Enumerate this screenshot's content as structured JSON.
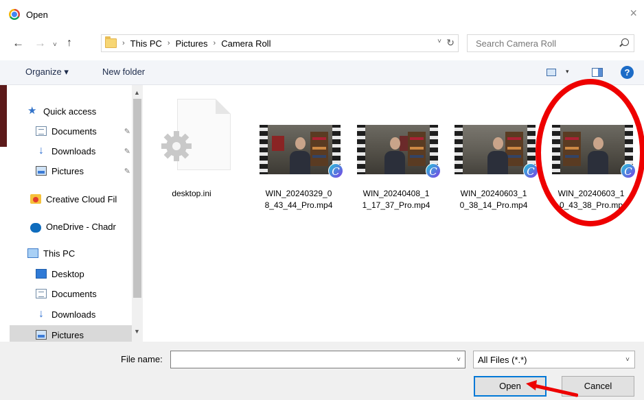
{
  "window": {
    "title": "Open",
    "close_glyph": "×"
  },
  "nav": {
    "back_glyph": "←",
    "forward_glyph": "→",
    "recent_glyph": "˅",
    "up_glyph": "↑",
    "breadcrumbs": [
      "This PC",
      "Pictures",
      "Camera Roll"
    ],
    "separator": "›",
    "address_dropdown_glyph": "˅",
    "refresh_glyph": "↻"
  },
  "search": {
    "placeholder": "Search Camera Roll"
  },
  "toolbar": {
    "organize_label": "Organize ▾",
    "new_folder_label": "New folder",
    "view_caret": "▾",
    "help_glyph": "?"
  },
  "sidebar": {
    "items": [
      {
        "label": "Quick access",
        "icon": "star-icon",
        "pinned": false
      },
      {
        "label": "Documents",
        "icon": "documents-icon",
        "pinned": true
      },
      {
        "label": "Downloads",
        "icon": "downloads-icon",
        "pinned": true
      },
      {
        "label": "Pictures",
        "icon": "pictures-icon",
        "pinned": true
      },
      {
        "label": "Creative Cloud Fil",
        "icon": "creative-cloud-icon",
        "pinned": false
      },
      {
        "label": "OneDrive - Chadr",
        "icon": "onedrive-icon",
        "pinned": false
      },
      {
        "label": "This PC",
        "icon": "this-pc-icon",
        "pinned": false
      },
      {
        "label": "Desktop",
        "icon": "desktop-icon",
        "pinned": false
      },
      {
        "label": "Documents",
        "icon": "documents-icon",
        "pinned": false
      },
      {
        "label": "Downloads",
        "icon": "downloads-icon",
        "pinned": false
      },
      {
        "label": "Pictures",
        "icon": "pictures-icon",
        "pinned": false
      }
    ],
    "pin_glyph": "📌",
    "scroll_up_glyph": "▲",
    "scroll_down_glyph": "▼"
  },
  "files": [
    {
      "label_lines": [
        "desktop.ini",
        ""
      ],
      "kind": "settings-file-icon"
    },
    {
      "label_lines": [
        "WIN_20240329_0",
        "8_43_44_Pro.mp4"
      ],
      "kind": "video-thumbnail"
    },
    {
      "label_lines": [
        "WIN_20240408_1",
        "1_17_37_Pro.mp4"
      ],
      "kind": "video-thumbnail"
    },
    {
      "label_lines": [
        "WIN_20240603_1",
        "0_38_14_Pro.mp4"
      ],
      "kind": "video-thumbnail"
    },
    {
      "label_lines": [
        "WIN_20240603_1",
        "0_43_38_Pro.mp"
      ],
      "kind": "video-thumbnail"
    }
  ],
  "canva_glyph": "C",
  "bottom": {
    "file_name_label": "File name:",
    "file_name_value": "",
    "file_type_value": "All Files (*.*)",
    "caret_glyph": "˅",
    "open_label": "Open",
    "cancel_label": "Cancel"
  },
  "colors": {
    "annotation_red": "#ee0000",
    "accent_blue": "#0078d7"
  }
}
